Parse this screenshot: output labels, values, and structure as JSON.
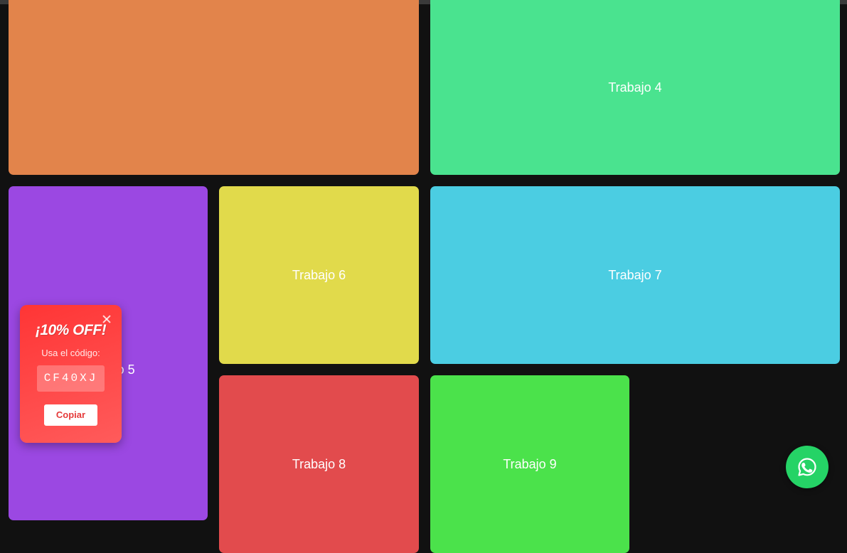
{
  "tiles": [
    {
      "id": "t3",
      "label": ""
    },
    {
      "id": "t4",
      "label": "Trabajo 4"
    },
    {
      "id": "t5",
      "label": "Trabajo 5"
    },
    {
      "id": "t6",
      "label": "Trabajo 6"
    },
    {
      "id": "t7",
      "label": "Trabajo 7"
    },
    {
      "id": "t8",
      "label": "Trabajo 8"
    },
    {
      "id": "t9",
      "label": "Trabajo 9"
    }
  ],
  "promo": {
    "title": "¡10% OFF!",
    "subtitle": "Usa el código:",
    "code": "CF40XJ",
    "button": "Copiar"
  },
  "icons": {
    "close": "close-icon",
    "whatsapp": "whatsapp-icon"
  },
  "colors": {
    "orange": "#e2844b",
    "green": "#4ae38f",
    "purple": "#9b48e2",
    "yellow": "#e1da4b",
    "cyan": "#4bcde2",
    "red": "#e24b4d",
    "lime": "#4be24b",
    "whatsapp": "#25d366",
    "promo": "#ff3535"
  }
}
